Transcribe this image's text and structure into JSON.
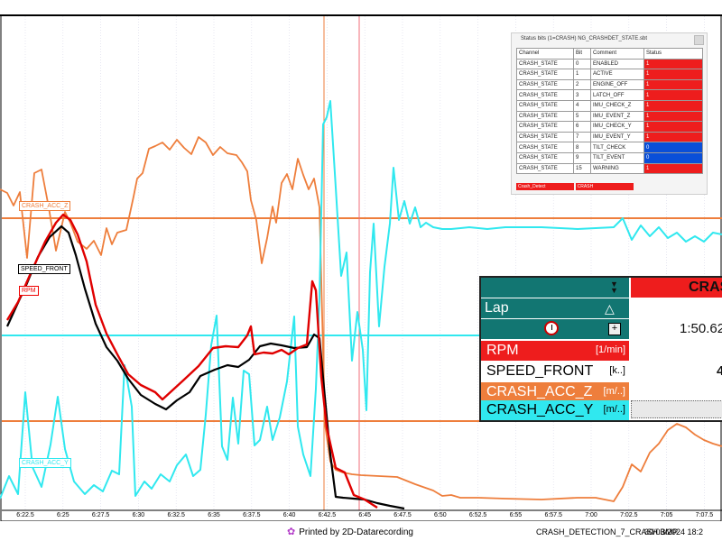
{
  "chart_data": {
    "type": "line",
    "title": "",
    "xlabel": "",
    "ylabel": "",
    "x_ticks": [
      "6:22.5",
      "6:25",
      "6:27.5",
      "6:30",
      "6:32.5",
      "6:35",
      "6:37.5",
      "6:40",
      "6:42.5",
      "6:45",
      "6:47.5",
      "6:50",
      "6:52.5",
      "6:55",
      "6:57.5",
      "7:00",
      "7:02.5",
      "7:05",
      "7:07.5"
    ],
    "x_range_seconds": [
      381,
      449
    ],
    "series": [
      {
        "name": "CRASH_ACC_Z",
        "color": "#ee7e3c"
      },
      {
        "name": "SPEED_FRONT",
        "color": "#000000"
      },
      {
        "name": "RPM",
        "color": "#e00000"
      },
      {
        "name": "CRASH_ACC_Y",
        "color": "#30e8ef"
      }
    ],
    "orange_path": [
      [
        0,
        210
      ],
      [
        8,
        214
      ],
      [
        15,
        228
      ],
      [
        22,
        213
      ],
      [
        30,
        286
      ],
      [
        38,
        192
      ],
      [
        46,
        188
      ],
      [
        54,
        230
      ],
      [
        62,
        278
      ],
      [
        72,
        235
      ],
      [
        78,
        247
      ],
      [
        86,
        268
      ],
      [
        96,
        276
      ],
      [
        104,
        267
      ],
      [
        112,
        283
      ],
      [
        118,
        253
      ],
      [
        124,
        271
      ],
      [
        130,
        258
      ],
      [
        140,
        255
      ],
      [
        148,
        218
      ],
      [
        152,
        198
      ],
      [
        158,
        192
      ],
      [
        165,
        165
      ],
      [
        172,
        162
      ],
      [
        180,
        158
      ],
      [
        188,
        166
      ],
      [
        196,
        155
      ],
      [
        204,
        164
      ],
      [
        212,
        171
      ],
      [
        220,
        152
      ],
      [
        228,
        158
      ],
      [
        236,
        172
      ],
      [
        244,
        163
      ],
      [
        252,
        170
      ],
      [
        262,
        172
      ],
      [
        268,
        180
      ],
      [
        274,
        190
      ],
      [
        278,
        222
      ],
      [
        284,
        244
      ],
      [
        290,
        292
      ],
      [
        296,
        264
      ],
      [
        302,
        229
      ],
      [
        306,
        247
      ],
      [
        312,
        203
      ],
      [
        318,
        193
      ],
      [
        324,
        210
      ],
      [
        330,
        176
      ],
      [
        336,
        194
      ],
      [
        342,
        210
      ],
      [
        348,
        198
      ],
      [
        354,
        230
      ],
      [
        360,
        470
      ],
      [
        366,
        512
      ],
      [
        372,
        521
      ],
      [
        380,
        524
      ],
      [
        390,
        526
      ],
      [
        400,
        527
      ],
      [
        420,
        528
      ],
      [
        440,
        529
      ],
      [
        460,
        537
      ],
      [
        480,
        544
      ],
      [
        490,
        550
      ],
      [
        500,
        549
      ],
      [
        510,
        552
      ],
      [
        530,
        552
      ],
      [
        560,
        553
      ],
      [
        600,
        554
      ],
      [
        640,
        552
      ],
      [
        660,
        552
      ],
      [
        680,
        556
      ],
      [
        690,
        540
      ],
      [
        700,
        515
      ],
      [
        710,
        523
      ],
      [
        720,
        502
      ],
      [
        730,
        492
      ],
      [
        740,
        477
      ],
      [
        750,
        470
      ],
      [
        760,
        474
      ],
      [
        770,
        482
      ],
      [
        780,
        488
      ],
      [
        790,
        492
      ],
      [
        800,
        495
      ]
    ],
    "speed_path": [
      [
        8,
        362
      ],
      [
        18,
        340
      ],
      [
        30,
        314
      ],
      [
        42,
        285
      ],
      [
        55,
        263
      ],
      [
        68,
        251
      ],
      [
        76,
        258
      ],
      [
        84,
        283
      ],
      [
        94,
        320
      ],
      [
        106,
        359
      ],
      [
        118,
        385
      ],
      [
        130,
        400
      ],
      [
        142,
        420
      ],
      [
        156,
        438
      ],
      [
        172,
        448
      ],
      [
        184,
        454
      ],
      [
        196,
        444
      ],
      [
        210,
        435
      ],
      [
        222,
        417
      ],
      [
        238,
        410
      ],
      [
        252,
        405
      ],
      [
        264,
        407
      ],
      [
        276,
        399
      ],
      [
        288,
        384
      ],
      [
        300,
        381
      ],
      [
        312,
        383
      ],
      [
        326,
        386
      ],
      [
        340,
        385
      ],
      [
        348,
        371
      ],
      [
        354,
        375
      ],
      [
        360,
        441
      ],
      [
        366,
        504
      ],
      [
        372,
        551
      ],
      [
        380,
        552
      ],
      [
        392,
        553
      ],
      [
        404,
        554
      ],
      [
        418,
        558
      ],
      [
        432,
        561
      ],
      [
        448,
        564
      ]
    ],
    "rpm_path": [
      [
        8,
        355
      ],
      [
        20,
        335
      ],
      [
        34,
        303
      ],
      [
        50,
        268
      ],
      [
        62,
        247
      ],
      [
        70,
        238
      ],
      [
        78,
        244
      ],
      [
        86,
        260
      ],
      [
        96,
        290
      ],
      [
        106,
        338
      ],
      [
        118,
        370
      ],
      [
        130,
        393
      ],
      [
        142,
        415
      ],
      [
        156,
        427
      ],
      [
        172,
        435
      ],
      [
        180,
        443
      ],
      [
        192,
        432
      ],
      [
        204,
        421
      ],
      [
        220,
        406
      ],
      [
        236,
        386
      ],
      [
        250,
        384
      ],
      [
        264,
        385
      ],
      [
        274,
        372
      ],
      [
        278,
        362
      ],
      [
        282,
        393
      ],
      [
        292,
        391
      ],
      [
        302,
        392
      ],
      [
        312,
        388
      ],
      [
        320,
        393
      ],
      [
        330,
        386
      ],
      [
        340,
        382
      ],
      [
        346,
        312
      ],
      [
        350,
        322
      ],
      [
        356,
        418
      ],
      [
        362,
        474
      ],
      [
        372,
        519
      ],
      [
        382,
        524
      ],
      [
        392,
        549
      ],
      [
        404,
        554
      ],
      [
        418,
        563
      ]
    ],
    "cyan_path": [
      [
        0,
        553
      ],
      [
        10,
        528
      ],
      [
        20,
        548
      ],
      [
        28,
        435
      ],
      [
        36,
        518
      ],
      [
        46,
        540
      ],
      [
        56,
        493
      ],
      [
        64,
        440
      ],
      [
        72,
        498
      ],
      [
        82,
        534
      ],
      [
        94,
        548
      ],
      [
        104,
        538
      ],
      [
        114,
        545
      ],
      [
        124,
        522
      ],
      [
        132,
        526
      ],
      [
        138,
        405
      ],
      [
        146,
        451
      ],
      [
        150,
        550
      ],
      [
        160,
        534
      ],
      [
        168,
        542
      ],
      [
        178,
        526
      ],
      [
        188,
        534
      ],
      [
        196,
        516
      ],
      [
        206,
        504
      ],
      [
        214,
        528
      ],
      [
        222,
        521
      ],
      [
        228,
        460
      ],
      [
        234,
        383
      ],
      [
        240,
        350
      ],
      [
        246,
        495
      ],
      [
        252,
        510
      ],
      [
        258,
        441
      ],
      [
        264,
        492
      ],
      [
        270,
        411
      ],
      [
        276,
        415
      ],
      [
        282,
        494
      ],
      [
        288,
        488
      ],
      [
        296,
        451
      ],
      [
        302,
        488
      ],
      [
        310,
        463
      ],
      [
        318,
        423
      ],
      [
        326,
        351
      ],
      [
        330,
        473
      ],
      [
        336,
        504
      ],
      [
        344,
        528
      ],
      [
        350,
        431
      ],
      [
        354,
        330
      ],
      [
        356,
        236
      ],
      [
        358,
        138
      ],
      [
        362,
        130
      ],
      [
        366,
        112
      ],
      [
        372,
        208
      ],
      [
        378,
        306
      ],
      [
        384,
        280
      ],
      [
        390,
        400
      ],
      [
        396,
        346
      ],
      [
        402,
        388
      ],
      [
        406,
        455
      ],
      [
        410,
        302
      ],
      [
        414,
        248
      ],
      [
        420,
        362
      ],
      [
        426,
        296
      ],
      [
        432,
        248
      ],
      [
        436,
        186
      ],
      [
        442,
        244
      ],
      [
        448,
        223
      ],
      [
        454,
        248
      ],
      [
        460,
        230
      ],
      [
        466,
        252
      ],
      [
        472,
        247
      ],
      [
        480,
        252
      ],
      [
        490,
        254
      ],
      [
        500,
        254
      ],
      [
        520,
        252
      ],
      [
        540,
        254
      ],
      [
        560,
        252
      ],
      [
        600,
        252
      ],
      [
        640,
        254
      ],
      [
        680,
        252
      ],
      [
        690,
        242
      ],
      [
        700,
        266
      ],
      [
        710,
        250
      ],
      [
        720,
        262
      ],
      [
        730,
        252
      ],
      [
        740,
        264
      ],
      [
        750,
        258
      ],
      [
        760,
        268
      ],
      [
        770,
        262
      ],
      [
        780,
        268
      ],
      [
        790,
        258
      ],
      [
        800,
        260
      ]
    ],
    "hlines": [
      {
        "color": "#ee7e3c",
        "y": 242
      },
      {
        "color": "#30e8ef",
        "y": 372
      },
      {
        "color": "#ee7e3c",
        "y": 467
      }
    ],
    "vlines": [
      {
        "color": "#ee7e3c",
        "x": 359
      },
      {
        "color": "#f06e78",
        "x": 398
      }
    ],
    "grid": true,
    "legend_placement": "inline-left"
  },
  "status_panel": {
    "title": "Status bits (1=CRASH)   NG_CRASHDET_STATE.sbt",
    "headers": [
      "Channel",
      "Bit",
      "Comment",
      "Status"
    ],
    "rows": [
      {
        "channel": "CRASH_STATE",
        "bit": "0",
        "comment": "ENABLED",
        "status": "1",
        "color": "red"
      },
      {
        "channel": "CRASH_STATE",
        "bit": "1",
        "comment": "ACTIVE",
        "status": "1",
        "color": "red"
      },
      {
        "channel": "CRASH_STATE",
        "bit": "2",
        "comment": "ENGINE_OFF",
        "status": "1",
        "color": "red"
      },
      {
        "channel": "CRASH_STATE",
        "bit": "3",
        "comment": "LATCH_OFF",
        "status": "1",
        "color": "red"
      },
      {
        "channel": "CRASH_STATE",
        "bit": "4",
        "comment": "IMU_CHECK_Z",
        "status": "1",
        "color": "red"
      },
      {
        "channel": "CRASH_STATE",
        "bit": "5",
        "comment": "IMU_EVENT_Z",
        "status": "1",
        "color": "red"
      },
      {
        "channel": "CRASH_STATE",
        "bit": "6",
        "comment": "IMU_CHECK_Y",
        "status": "1",
        "color": "red"
      },
      {
        "channel": "CRASH_STATE",
        "bit": "7",
        "comment": "IMU_EVENT_Y",
        "status": "1",
        "color": "red"
      },
      {
        "channel": "CRASH_STATE",
        "bit": "8",
        "comment": "TILT_CHECK",
        "status": "0",
        "color": "blue"
      },
      {
        "channel": "CRASH_STATE",
        "bit": "9",
        "comment": "TILT_EVENT",
        "status": "0",
        "color": "blue"
      },
      {
        "channel": "CRASH_STATE",
        "bit": "15",
        "comment": "WARNING",
        "status": "1",
        "color": "red"
      }
    ],
    "footer_left": "Crash_Detect",
    "footer_right": "CRASH"
  },
  "measure_panel": {
    "header_right": "CRAS",
    "lap_label": "Lap",
    "delta_symbol": "△",
    "time_value": "1:50.62",
    "plus_symbol": "+",
    "channels": [
      {
        "name": "RPM",
        "unit": "[1/min]",
        "value": ""
      },
      {
        "name": "SPEED_FRONT",
        "unit": "[k..]",
        "value": "4"
      },
      {
        "name": "CRASH_ACC_Z",
        "unit": "[m/..]",
        "value": ""
      },
      {
        "name": "CRASH_ACC_Y",
        "unit": "[m/..]",
        "value": ""
      }
    ]
  },
  "series_labels": {
    "acc_z": "CRASH_ACC_Z",
    "speed": "SPEED_FRONT",
    "rpm": "RPM",
    "acc_y": "CRASH_ACC_Y"
  },
  "footer": {
    "printed": "Printed by 2D-Datarecording",
    "filename": "CRASH_DETECTION_7_CRASH.BMP",
    "date": "30/03/2024 18:2"
  }
}
